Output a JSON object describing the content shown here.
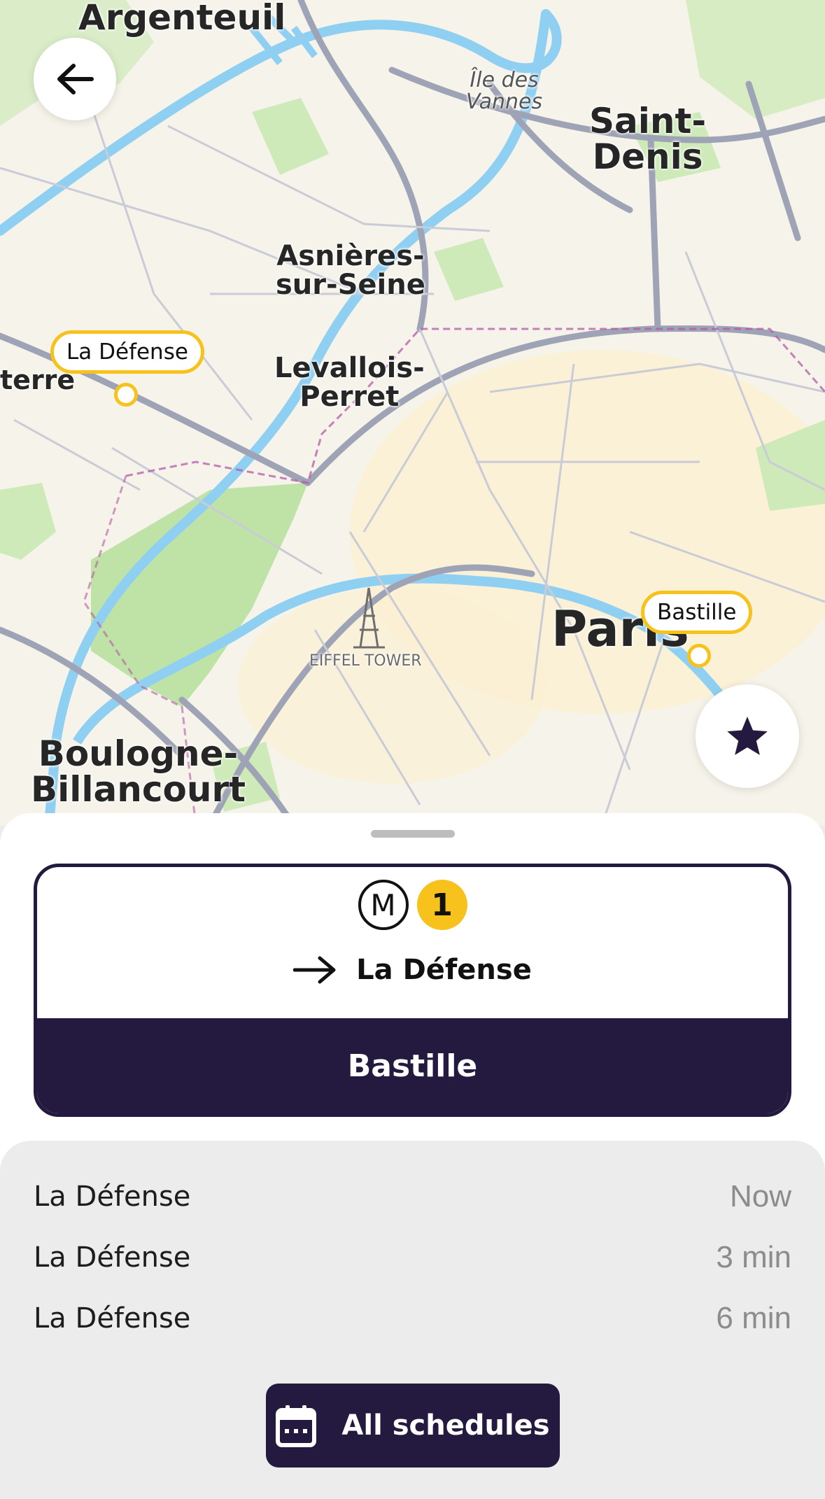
{
  "map": {
    "places": {
      "argenteuil": "Argenteuil",
      "ile_des_vannes": "Île des\nVannes",
      "saint_denis": "Saint-\nDenis",
      "asnieres": "Asnières-\nsur-Seine",
      "levallois": "Levallois-\nPerret",
      "nanterre": "terre",
      "paris": "Paris",
      "eiffel": "EIFFEL TOWER",
      "boulogne": "Boulogne-\nBillancourt"
    },
    "pins": {
      "origin": "La Défense",
      "destination": "Bastille"
    },
    "colors": {
      "pin": "#f6c21b",
      "park": "#c9e8b0",
      "river": "#8fd0f2",
      "road": "#9ea3b5"
    }
  },
  "buttons": {
    "back_icon": "arrow-left-icon",
    "favorite_icon": "star-icon"
  },
  "line_card": {
    "mode_badge": "M",
    "line_number": "1",
    "direction": "La Défense",
    "station": "Bastille",
    "accent": "#241a3f",
    "line_color": "#f6c21b"
  },
  "departures": [
    {
      "destination": "La Défense",
      "time": "Now"
    },
    {
      "destination": "La Défense",
      "time": "3 min"
    },
    {
      "destination": "La Défense",
      "time": "6 min"
    }
  ],
  "all_schedules": {
    "label": "All schedules",
    "icon": "calendar-icon"
  }
}
